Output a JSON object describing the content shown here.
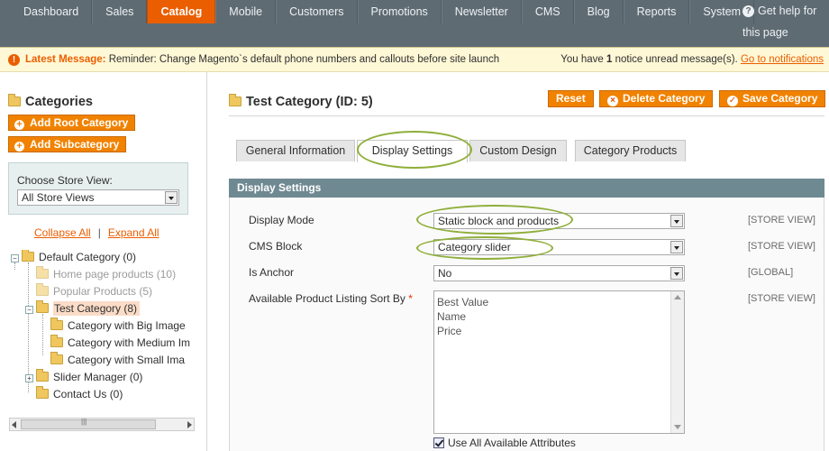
{
  "nav": {
    "items": [
      "Dashboard",
      "Sales",
      "Catalog",
      "Mobile",
      "Customers",
      "Promotions",
      "Newsletter",
      "CMS",
      "Blog",
      "Reports",
      "System"
    ],
    "active": "Catalog",
    "help_line1": "Get help for",
    "help_line2": "this page"
  },
  "notice": {
    "label": "Latest Message:",
    "message": "Reminder: Change Magento`s default phone numbers and callouts before site launch",
    "right_prefix": "You have",
    "count": "1",
    "right_suffix": "notice unread message(s).",
    "link": "Go to notifications"
  },
  "sidebar": {
    "title": "Categories",
    "add_root": "Add Root Category",
    "add_sub": "Add Subcategory",
    "store_view_label": "Choose Store View:",
    "store_view_value": "All Store Views",
    "collapse_all": "Collapse All",
    "separator": "|",
    "expand_all": "Expand All",
    "tree": [
      {
        "label": "Default Category (0)"
      },
      {
        "label": "Home page products (10)"
      },
      {
        "label": "Popular Products (5)"
      },
      {
        "label": "Test Category (8)"
      },
      {
        "label": "Category with Big Image"
      },
      {
        "label": "Category with Medium Im"
      },
      {
        "label": "Category with Small Ima"
      },
      {
        "label": "Slider Manager (0)"
      },
      {
        "label": "Contact Us (0)"
      }
    ]
  },
  "main": {
    "title": "Test Category (ID: 5)",
    "buttons": {
      "reset": "Reset",
      "delete": "Delete Category",
      "save": "Save Category"
    },
    "tabs": [
      "General Information",
      "Display Settings",
      "Custom Design",
      "Category Products"
    ],
    "active_tab": "Display Settings",
    "section_title": "Display Settings",
    "fields": {
      "display_mode": {
        "label": "Display Mode",
        "value": "Static block and products",
        "scope": "[STORE VIEW]"
      },
      "cms_block": {
        "label": "CMS Block",
        "value": "Category slider",
        "scope": "[STORE VIEW]"
      },
      "is_anchor": {
        "label": "Is Anchor",
        "value": "No",
        "scope": "[GLOBAL]"
      },
      "sort_by": {
        "label": "Available Product Listing Sort By",
        "required_mark": "*",
        "scope": "[STORE VIEW]",
        "options": [
          "Best Value",
          "Name",
          "Price"
        ]
      },
      "use_all": {
        "label": "Use All Available Attributes",
        "checked": true
      }
    }
  },
  "colors": {
    "accent": "#eb5e00",
    "nav_bg": "#5f6b73",
    "section_head": "#6f8992",
    "highlight_ring": "#8fae3a"
  }
}
